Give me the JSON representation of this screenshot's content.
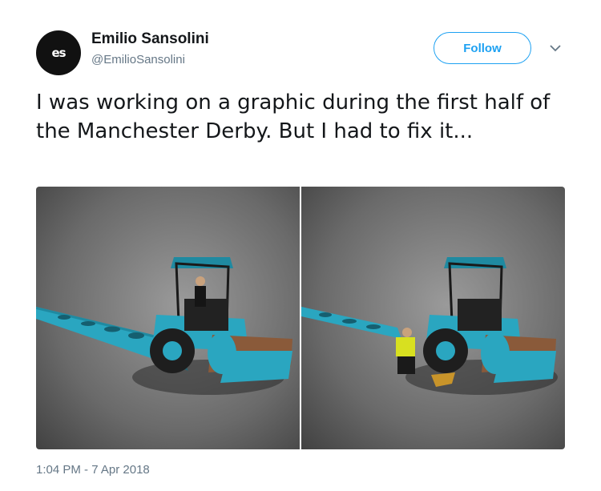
{
  "author": {
    "avatar_initials": "es",
    "display_name": "Emilio Sansolini",
    "handle": "@EmilioSansolini"
  },
  "actions": {
    "follow_label": "Follow",
    "more_icon": "chevron-down-icon"
  },
  "tweet": {
    "text": "I was working on a graphic during the first half of the Manchester Derby. But I had to fix it...",
    "timestamp": "1:04 PM - 7 Apr 2018"
  },
  "media": [
    {
      "description_icon": "road-roller-image"
    },
    {
      "description_icon": "road-roller-repair-image"
    }
  ],
  "colors": {
    "accent": "#1da1f2",
    "secondary_text": "#657786",
    "roller_teal": "#2aa6c0"
  }
}
